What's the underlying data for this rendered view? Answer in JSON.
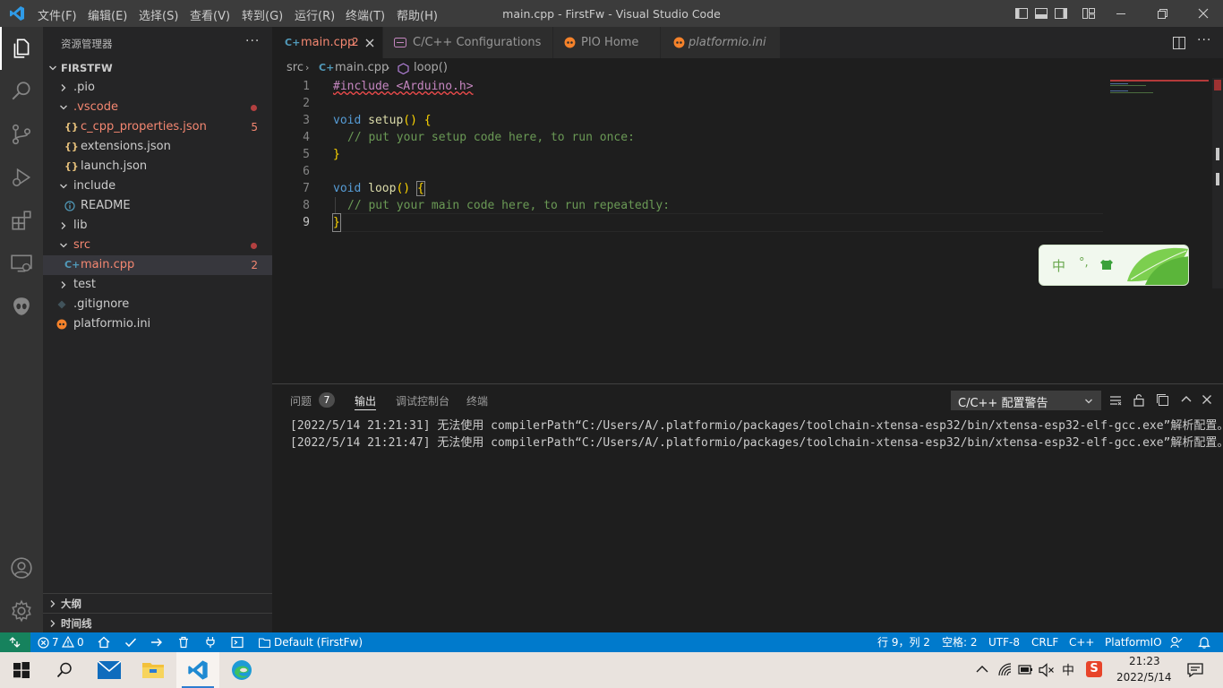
{
  "menu": [
    "文件(F)",
    "编辑(E)",
    "选择(S)",
    "查看(V)",
    "转到(G)",
    "运行(R)",
    "终端(T)",
    "帮助(H)"
  ],
  "window_title": "main.cpp - FirstFw - Visual Studio Code",
  "sidebar": {
    "title": "资源管理器",
    "more": "···",
    "root": "FIRSTFW",
    "items": [
      {
        "label": ".pio"
      },
      {
        "label": ".vscode"
      },
      {
        "label": "c_cpp_properties.json",
        "badge": "5"
      },
      {
        "label": "extensions.json"
      },
      {
        "label": "launch.json"
      },
      {
        "label": "include"
      },
      {
        "label": "README"
      },
      {
        "label": "lib"
      },
      {
        "label": "src"
      },
      {
        "label": "main.cpp",
        "badge": "2"
      },
      {
        "label": "test"
      },
      {
        "label": ".gitignore"
      },
      {
        "label": "platformio.ini"
      }
    ],
    "outline": "大纲",
    "timeline": "时间线"
  },
  "tabs": [
    {
      "label": "main.cpp",
      "badge": "2"
    },
    {
      "label": "C/C++ Configurations"
    },
    {
      "label": "PIO Home"
    },
    {
      "label": "platformio.ini"
    }
  ],
  "breadcrumb": {
    "folder": "src",
    "file": "main.cpp",
    "symbol": "loop()"
  },
  "code": {
    "line_numbers": [
      "1",
      "2",
      "3",
      "4",
      "5",
      "6",
      "7",
      "8",
      "9"
    ],
    "l1": "#include <Arduino.h>",
    "l3_kw": "void",
    "l3_fn": "setup",
    "l3_rest": "() {",
    "l4": "// put your setup code here, to run once:",
    "l5": "}",
    "l7_kw": "void",
    "l7_fn": "loop",
    "l7_paren": "()",
    "l7_brace": "{",
    "l8": "// put your main code here, to run repeatedly:",
    "l9": "}"
  },
  "ime": {
    "char1": "中",
    "char2": "°,"
  },
  "panel": {
    "tabs": [
      "问题",
      "输出",
      "调试控制台",
      "终端"
    ],
    "problems_count": "7",
    "dropdown": "C/C++ 配置警告",
    "lines": [
      "[2022/5/14 21:21:31] 无法使用 compilerPath“C:/Users/A/.platformio/packages/toolchain-xtensa-esp32/bin/xtensa-esp32-elf-gcc.exe”解析配置。",
      "[2022/5/14 21:21:47] 无法使用 compilerPath“C:/Users/A/.platformio/packages/toolchain-xtensa-esp32/bin/xtensa-esp32-elf-gcc.exe”解析配置。"
    ]
  },
  "status": {
    "errors": "7",
    "warnings": "0",
    "env": "Default (FirstFw)",
    "position": "行 9，列 2",
    "spaces": "空格: 2",
    "encoding": "UTF-8",
    "eol": "CRLF",
    "language": "C++",
    "platform": "PlatformIO"
  },
  "taskbar": {
    "time": "21:23",
    "date": "2022/5/14",
    "ime": "中"
  },
  "colors": {
    "accent": "#007acc",
    "activity": "#333333",
    "sidebar": "#252526",
    "editor": "#1e1e1e"
  }
}
